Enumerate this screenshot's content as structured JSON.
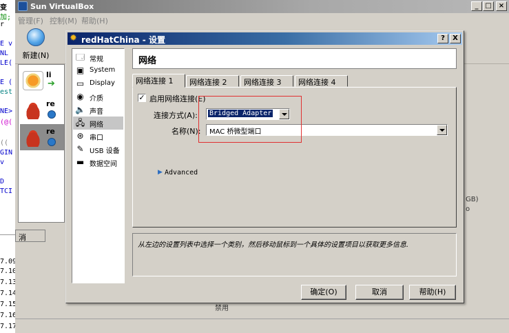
{
  "editor": {
    "lines": [
      "变​",
      "加;",
      "r",
      "E v",
      "NL",
      "LE(",
      "E (",
      "est",
      "NE>",
      "(@(",
      "((",
      "GIN",
      "v",
      "D",
      "TCI"
    ],
    "grid_rows": [
      "7.09",
      "7.10",
      "7.13",
      "7.14",
      "7.15",
      "7.16",
      "7.17"
    ],
    "grid_header": "消"
  },
  "vbox": {
    "title": "Sun VirtualBox",
    "menu": [
      "管理(F)",
      "控制(M)",
      "帮助(H)"
    ],
    "new_label": "新建(N)",
    "vms": [
      {
        "name": "li",
        "state": "running"
      },
      {
        "name": "re",
        "state": "saved"
      },
      {
        "name": "re",
        "state": "saved"
      }
    ],
    "status_tab": "消",
    "right_texts": [
      "GB)",
      "o",
      "禁用"
    ]
  },
  "dialog": {
    "title": "redHatChina - 设置",
    "categories": [
      "常规",
      "System",
      "Display",
      "介质",
      "声音",
      "网络",
      "串口",
      "USB 设备",
      "数据空间"
    ],
    "selected_category": "网络",
    "page_title": "网络",
    "tabs": [
      "网络连接 1",
      "网络连接 2",
      "网络连接 3",
      "网络连接 4"
    ],
    "active_tab": "网络连接 1",
    "enable_label": "启用网络连接(E)",
    "enable_checked": "✓",
    "attach_label": "连接方式(A):",
    "attach_value": "Bridged Adapter",
    "name_label": "名称(N):",
    "name_value": "MAC 桥微型端口",
    "advanced_label": "Advanced",
    "description": "从左边的设置列表中选择一个类别，然后移动鼠标到一个具体的设置项目以获取更多信息.",
    "buttons": {
      "ok": "确定(O)",
      "cancel": "取消",
      "help": "帮助(H)"
    },
    "help_button_title": "?",
    "close_button_title": "X"
  }
}
